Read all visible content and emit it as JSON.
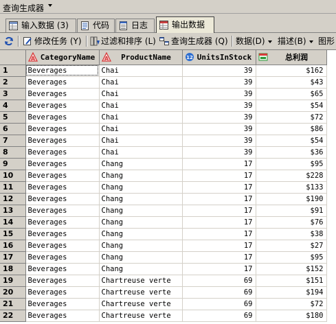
{
  "window": {
    "title": "查询生成器"
  },
  "tabs": [
    {
      "label": "输入数据 (3)",
      "icon": "table-icon"
    },
    {
      "label": "代码",
      "icon": "document-icon"
    },
    {
      "label": "日志",
      "icon": "log-icon"
    },
    {
      "label": "输出数据",
      "icon": "table-icon",
      "active": true
    }
  ],
  "toolbar": {
    "modify_task": "修改任务 (Y)",
    "filter_sort": "过滤和排序 (L)",
    "query_builder": "查询生成器 (Q)",
    "data_menu": "数据(D)",
    "describe_menu": "描述(B)",
    "graph_menu": "图形"
  },
  "columns": [
    {
      "name": "CategoryName",
      "icon": "character-column-icon"
    },
    {
      "name": "ProductName",
      "icon": "character-column-icon"
    },
    {
      "name": "UnitsInStock",
      "icon": "numeric-column-icon"
    },
    {
      "name": "总利润",
      "icon": "currency-column-icon"
    }
  ],
  "rows": [
    [
      "1",
      "Beverages",
      "Chai",
      "39",
      "$162"
    ],
    [
      "2",
      "Beverages",
      "Chai",
      "39",
      "$43"
    ],
    [
      "3",
      "Beverages",
      "Chai",
      "39",
      "$65"
    ],
    [
      "4",
      "Beverages",
      "Chai",
      "39",
      "$54"
    ],
    [
      "5",
      "Beverages",
      "Chai",
      "39",
      "$72"
    ],
    [
      "6",
      "Beverages",
      "Chai",
      "39",
      "$86"
    ],
    [
      "7",
      "Beverages",
      "Chai",
      "39",
      "$54"
    ],
    [
      "8",
      "Beverages",
      "Chai",
      "39",
      "$36"
    ],
    [
      "9",
      "Beverages",
      "Chang",
      "17",
      "$95"
    ],
    [
      "10",
      "Beverages",
      "Chang",
      "17",
      "$228"
    ],
    [
      "11",
      "Beverages",
      "Chang",
      "17",
      "$133"
    ],
    [
      "12",
      "Beverages",
      "Chang",
      "17",
      "$190"
    ],
    [
      "13",
      "Beverages",
      "Chang",
      "17",
      "$91"
    ],
    [
      "14",
      "Beverages",
      "Chang",
      "17",
      "$76"
    ],
    [
      "15",
      "Beverages",
      "Chang",
      "17",
      "$38"
    ],
    [
      "16",
      "Beverages",
      "Chang",
      "17",
      "$27"
    ],
    [
      "17",
      "Beverages",
      "Chang",
      "17",
      "$95"
    ],
    [
      "18",
      "Beverages",
      "Chang",
      "17",
      "$152"
    ],
    [
      "19",
      "Beverages",
      "Chartreuse verte",
      "69",
      "$151"
    ],
    [
      "20",
      "Beverages",
      "Chartreuse verte",
      "69",
      "$194"
    ],
    [
      "21",
      "Beverages",
      "Chartreuse verte",
      "69",
      "$72"
    ],
    [
      "22",
      "Beverages",
      "Chartreuse verte",
      "69",
      "$180"
    ]
  ],
  "colors": {
    "chrome": "#d4d0c8",
    "active_tab": "#ece9d8",
    "char_icon": "#d83a3a",
    "num_icon": "#2f6fd0",
    "currency_icon": "#2a9a3a"
  }
}
